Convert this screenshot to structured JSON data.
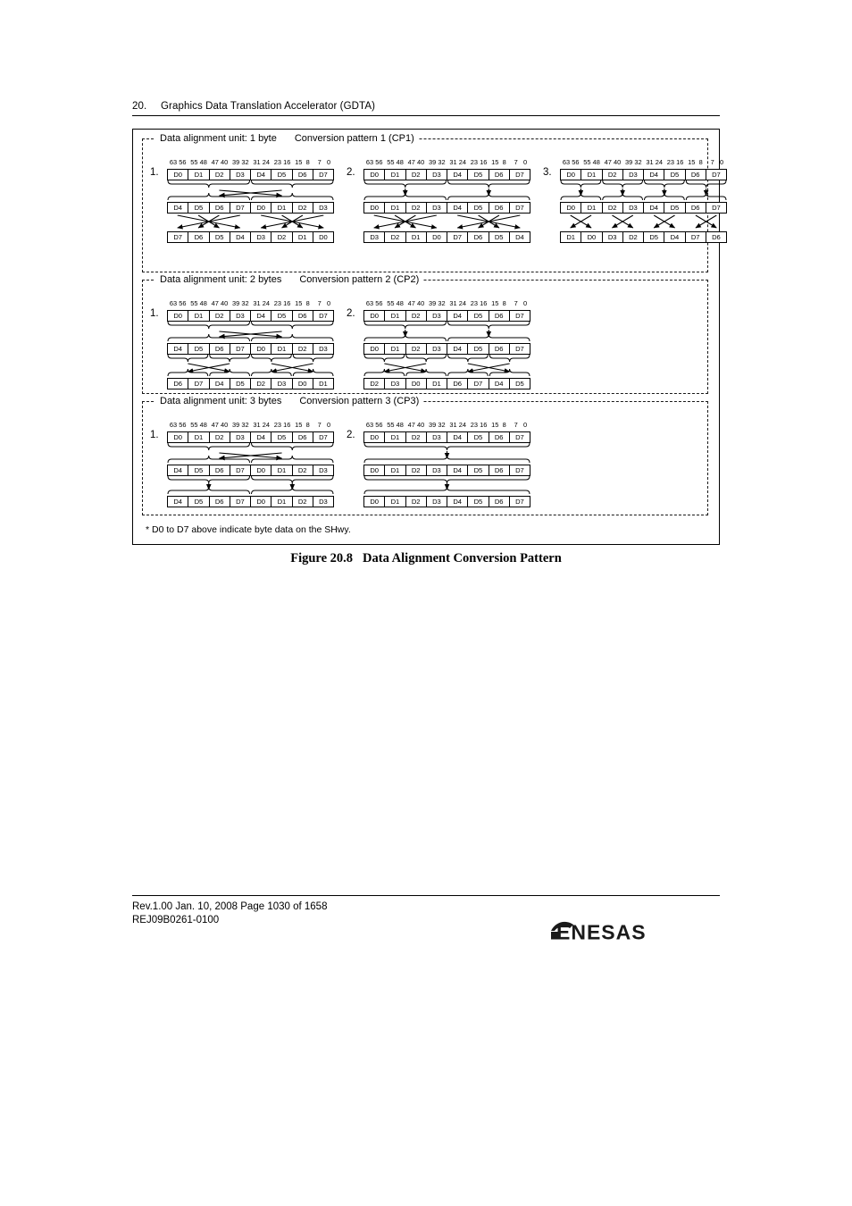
{
  "header": {
    "section_number": "20.",
    "section_title": "Graphics Data Translation Accelerator (GDTA)"
  },
  "figure": {
    "caption_label": "Figure 20.8",
    "caption_title": "Data Alignment Conversion Pattern",
    "footnote": "*  D0 to D7 above indicate byte data on the SHwy.",
    "bit_labels": [
      "63",
      "56",
      "55",
      "48",
      "47",
      "40",
      "39",
      "32",
      "31",
      "24",
      "23",
      "16",
      "15",
      "8",
      "7",
      "0"
    ],
    "groups": [
      {
        "unit_label": "Data alignment unit: 1 byte",
        "pattern_label": "Conversion pattern 1 (CP1)",
        "patterns": [
          {
            "index": "1.",
            "rows": [
              [
                "D0",
                "D1",
                "D2",
                "D3",
                "D4",
                "D5",
                "D6",
                "D7"
              ],
              [
                "D4",
                "D5",
                "D6",
                "D7",
                "D0",
                "D1",
                "D2",
                "D3"
              ],
              [
                "D7",
                "D6",
                "D5",
                "D4",
                "D3",
                "D2",
                "D1",
                "D0"
              ]
            ],
            "band1": "swap32",
            "band2": "reverse4"
          },
          {
            "index": "2.",
            "rows": [
              [
                "D0",
                "D1",
                "D2",
                "D3",
                "D4",
                "D5",
                "D6",
                "D7"
              ],
              [
                "D0",
                "D1",
                "D2",
                "D3",
                "D4",
                "D5",
                "D6",
                "D7"
              ],
              [
                "D3",
                "D2",
                "D1",
                "D0",
                "D7",
                "D6",
                "D5",
                "D4"
              ]
            ],
            "band1": "down2",
            "band2": "reverse4"
          },
          {
            "index": "3.",
            "rows": [
              [
                "D0",
                "D1",
                "D2",
                "D3",
                "D4",
                "D5",
                "D6",
                "D7"
              ],
              [
                "D0",
                "D1",
                "D2",
                "D3",
                "D4",
                "D5",
                "D6",
                "D7"
              ],
              [
                "D1",
                "D0",
                "D3",
                "D2",
                "D5",
                "D4",
                "D7",
                "D6"
              ]
            ],
            "band1": "down4",
            "band2": "cross4"
          }
        ]
      },
      {
        "unit_label": "Data alignment unit: 2 bytes",
        "pattern_label": "Conversion pattern 2 (CP2)",
        "patterns": [
          {
            "index": "1.",
            "rows": [
              [
                "D0",
                "D1",
                "D2",
                "D3",
                "D4",
                "D5",
                "D6",
                "D7"
              ],
              [
                "D4",
                "D5",
                "D6",
                "D7",
                "D0",
                "D1",
                "D2",
                "D3"
              ],
              [
                "D6",
                "D7",
                "D4",
                "D5",
                "D2",
                "D3",
                "D0",
                "D1"
              ]
            ],
            "band1": "swap32",
            "band2": "swap16x4"
          },
          {
            "index": "2.",
            "rows": [
              [
                "D0",
                "D1",
                "D2",
                "D3",
                "D4",
                "D5",
                "D6",
                "D7"
              ],
              [
                "D0",
                "D1",
                "D2",
                "D3",
                "D4",
                "D5",
                "D6",
                "D7"
              ],
              [
                "D2",
                "D3",
                "D0",
                "D1",
                "D6",
                "D7",
                "D4",
                "D5"
              ]
            ],
            "band1": "down2",
            "band2": "swap16x4"
          }
        ]
      },
      {
        "unit_label": "Data alignment unit: 3 bytes",
        "pattern_label": "Conversion pattern 3 (CP3)",
        "patterns": [
          {
            "index": "1.",
            "rows": [
              [
                "D0",
                "D1",
                "D2",
                "D3",
                "D4",
                "D5",
                "D6",
                "D7"
              ],
              [
                "D4",
                "D5",
                "D6",
                "D7",
                "D0",
                "D1",
                "D2",
                "D3"
              ],
              [
                "D4",
                "D5",
                "D6",
                "D7",
                "D0",
                "D1",
                "D2",
                "D3"
              ]
            ],
            "band1": "swap32",
            "band2": "down2brace"
          },
          {
            "index": "2.",
            "rows": [
              [
                "D0",
                "D1",
                "D2",
                "D3",
                "D4",
                "D5",
                "D6",
                "D7"
              ],
              [
                "D0",
                "D1",
                "D2",
                "D3",
                "D4",
                "D5",
                "D6",
                "D7"
              ],
              [
                "D0",
                "D1",
                "D2",
                "D3",
                "D4",
                "D5",
                "D6",
                "D7"
              ]
            ],
            "band1": "down1",
            "band2": "down1brace"
          }
        ]
      }
    ]
  },
  "footer": {
    "revision_line": "Rev.1.00  Jan. 10, 2008  Page 1030 of 1658",
    "document_number": "REJ09B0261-0100",
    "logo_text": "RENESAS"
  }
}
